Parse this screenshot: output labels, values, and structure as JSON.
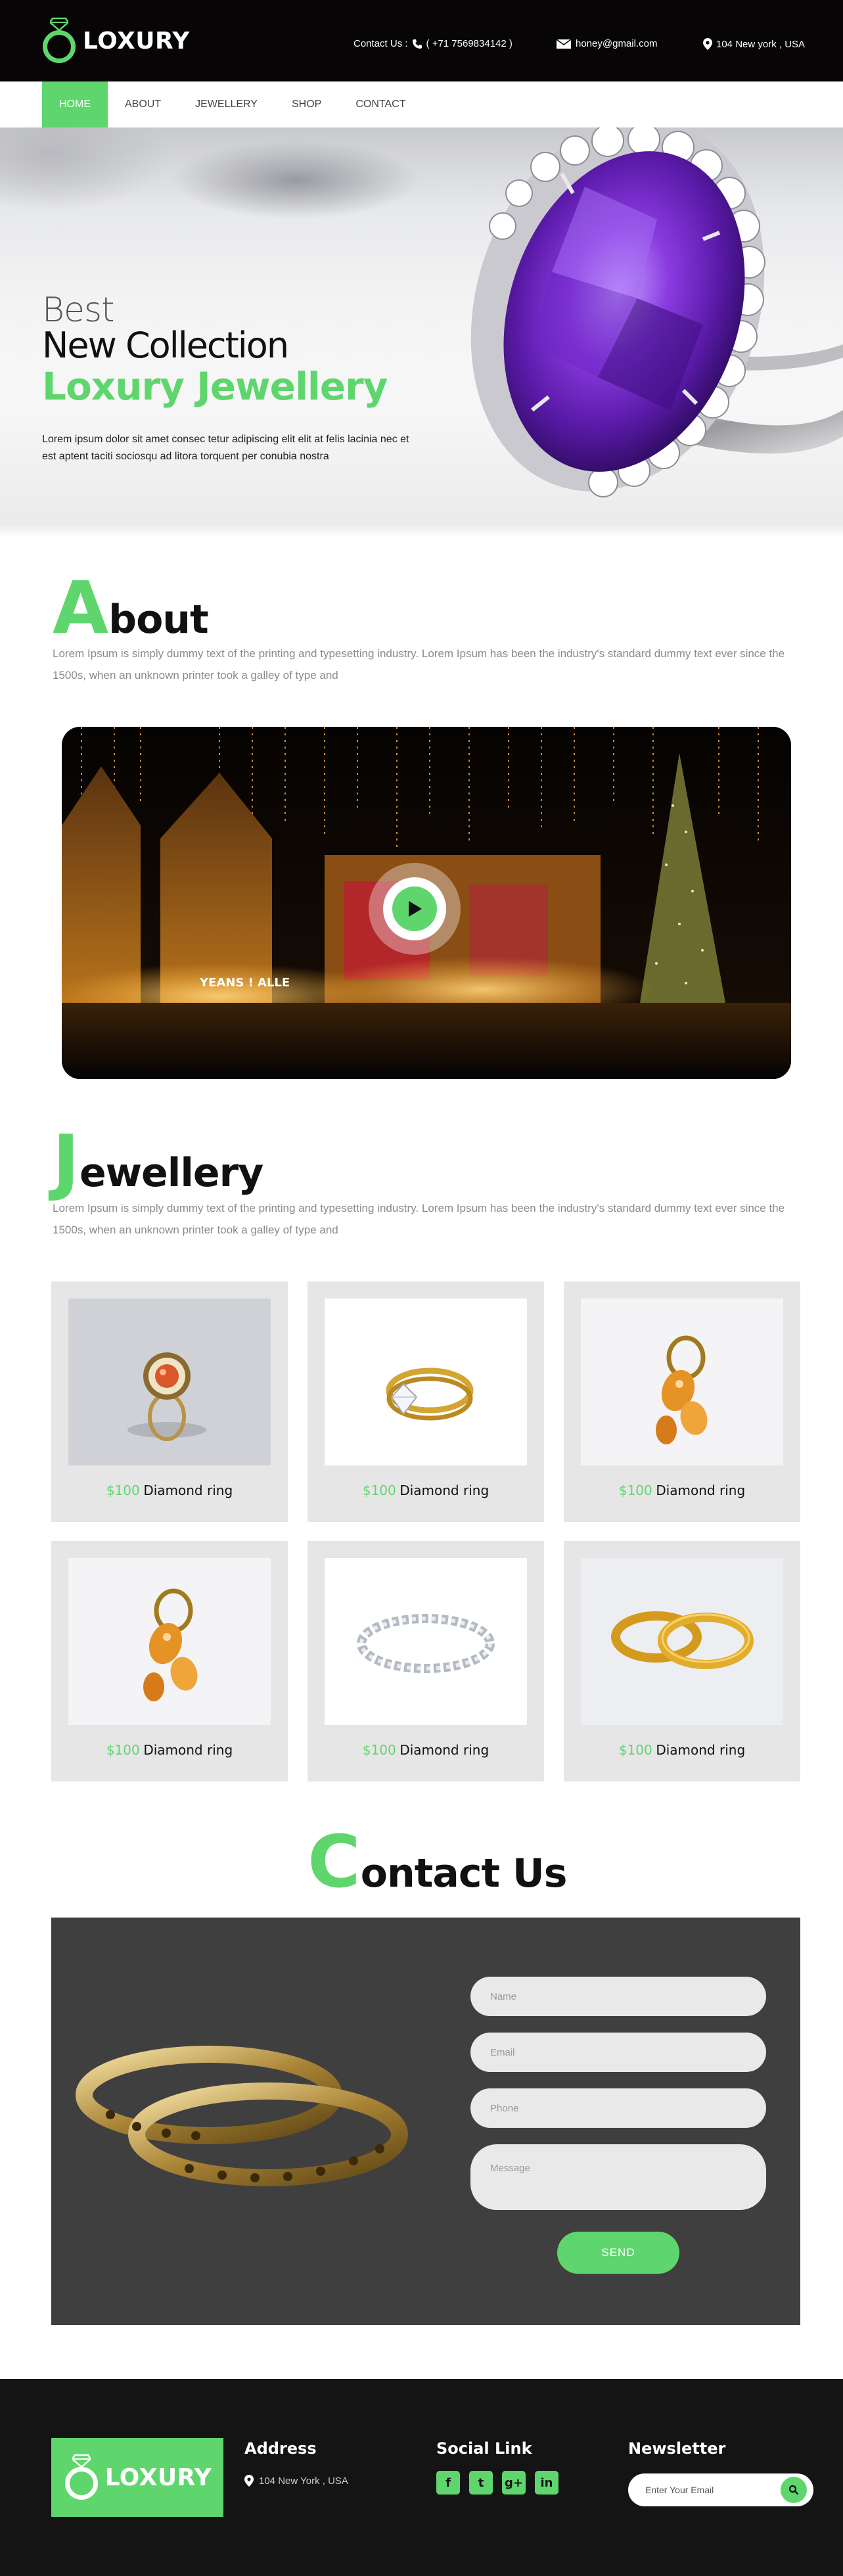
{
  "brand": {
    "name": "LOXURY",
    "accent_color": "#5fd66d",
    "dark_color": "#070506"
  },
  "topbar": {
    "contact_label": "Contact Us :",
    "phone": "( +71 7569834142 )",
    "email": "honey@gmail.com",
    "address": "104 New york , USA",
    "icons": [
      "phone-icon",
      "mail-icon",
      "location-pin-icon"
    ]
  },
  "nav": {
    "items": [
      "HOME",
      "ABOUT",
      "JEWELLERY",
      "SHOP",
      "CONTACT"
    ],
    "active": "HOME"
  },
  "hero": {
    "line1": "Best",
    "line2": "New Collection",
    "line3": "Loxury Jewellery",
    "text": "Lorem ipsum dolor sit amet consec tetur adipiscing elit elit at felis lacinia nec et est aptent taciti sociosqu ad litora torquent per conubia nostra"
  },
  "about": {
    "initial": "A",
    "rest": "bout",
    "text": "Lorem Ipsum is simply dummy text of the printing and typesetting industry. Lorem Ipsum has been the industry's standard dummy text ever since the 1500s, when an unknown printer took a galley of type and",
    "video_sign": "YEANS ! ALLE"
  },
  "jewellery": {
    "initial": "J",
    "rest": "ewellery",
    "text": "Lorem Ipsum is simply dummy text of the printing and typesetting industry. Lorem Ipsum has been the industry's standard dummy text ever since the 1500s, when an unknown printer took a galley of type and",
    "products": [
      {
        "price": "$100",
        "name": "Diamond ring",
        "image": "orange-gem-ring"
      },
      {
        "price": "$100",
        "name": "Diamond ring",
        "image": "gold-diamond-ring"
      },
      {
        "price": "$100",
        "name": "Diamond ring",
        "image": "amber-cluster-ring"
      },
      {
        "price": "$100",
        "name": "Diamond ring",
        "image": "amber-cluster-ring"
      },
      {
        "price": "$100",
        "name": "Diamond ring",
        "image": "diamond-band"
      },
      {
        "price": "$100",
        "name": "Diamond ring",
        "image": "gold-wedding-bands"
      }
    ]
  },
  "contact": {
    "initial": "C",
    "rest": "ontact Us",
    "name_placeholder": "Name",
    "email_placeholder": "Email",
    "phone_placeholder": "Phone",
    "message_placeholder": "Message",
    "send_label": "SEND"
  },
  "footer": {
    "address_heading": "Address",
    "address": "104 New York , USA",
    "social_heading": "Social Link",
    "social": [
      "f",
      "t",
      "g+",
      "in"
    ],
    "newsletter_heading": "Newsletter",
    "newsletter_placeholder": "Enter Your Email"
  }
}
